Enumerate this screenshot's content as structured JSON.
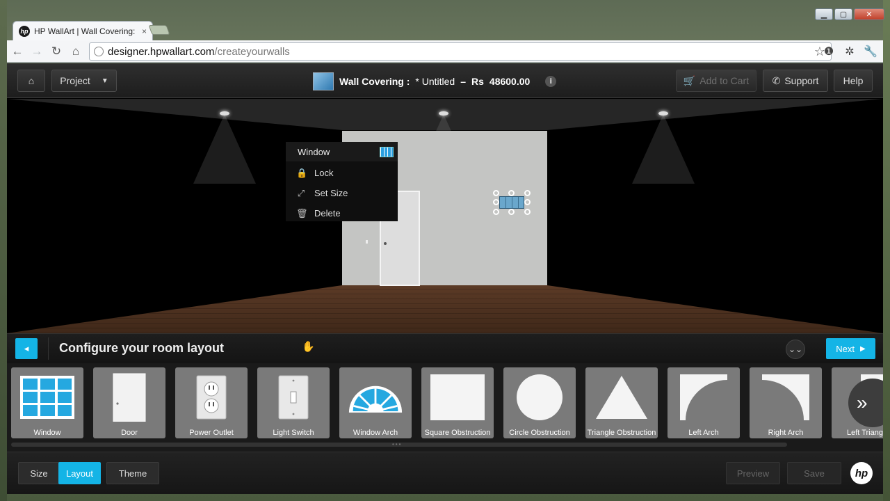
{
  "browser": {
    "tab_title": "HP WallArt | Wall Covering:",
    "tab_close": "×",
    "url_host": "designer.hpwallart.com",
    "url_path": "/createyourwalls"
  },
  "header": {
    "project_label": "Project",
    "wall_label": "Wall Covering :",
    "doc_name": "* Untitled",
    "dash": "–",
    "currency": "Rs",
    "price": "48600.00",
    "info": "i",
    "add_to_cart": "Add to Cart",
    "support": "Support",
    "help": "Help"
  },
  "context_menu": {
    "title": "Window",
    "items": [
      {
        "label": "Lock",
        "icon": "lock-icon",
        "glyph": "🔒"
      },
      {
        "label": "Set Size",
        "icon": "resize-icon",
        "glyph": "⤢"
      },
      {
        "label": "Delete",
        "icon": "trash-icon",
        "glyph": "🗑"
      }
    ]
  },
  "config": {
    "title": "Configure your room layout",
    "next": "Next"
  },
  "tiles": [
    {
      "label": "Window",
      "icon": "window-icon"
    },
    {
      "label": "Door",
      "icon": "door-icon"
    },
    {
      "label": "Power Outlet",
      "icon": "power-outlet-icon"
    },
    {
      "label": "Light Switch",
      "icon": "light-switch-icon"
    },
    {
      "label": "Window Arch",
      "icon": "window-arch-icon"
    },
    {
      "label": "Square Obstruction",
      "icon": "square-obstruction-icon"
    },
    {
      "label": "Circle Obstruction",
      "icon": "circle-obstruction-icon"
    },
    {
      "label": "Triangle Obstruction",
      "icon": "triangle-obstruction-icon"
    },
    {
      "label": "Left Arch",
      "icon": "left-arch-icon"
    },
    {
      "label": "Right Arch",
      "icon": "right-arch-icon"
    },
    {
      "label": "Left Triang",
      "icon": "left-triangle-icon"
    }
  ],
  "bottom": {
    "size": "Size",
    "layout": "Layout",
    "theme": "Theme",
    "preview": "Preview",
    "save": "Save",
    "logo": "hp"
  },
  "colors": {
    "accent": "#14b4e6",
    "tile_bg": "#7a7a7a",
    "wall": "#c4c5c3"
  }
}
